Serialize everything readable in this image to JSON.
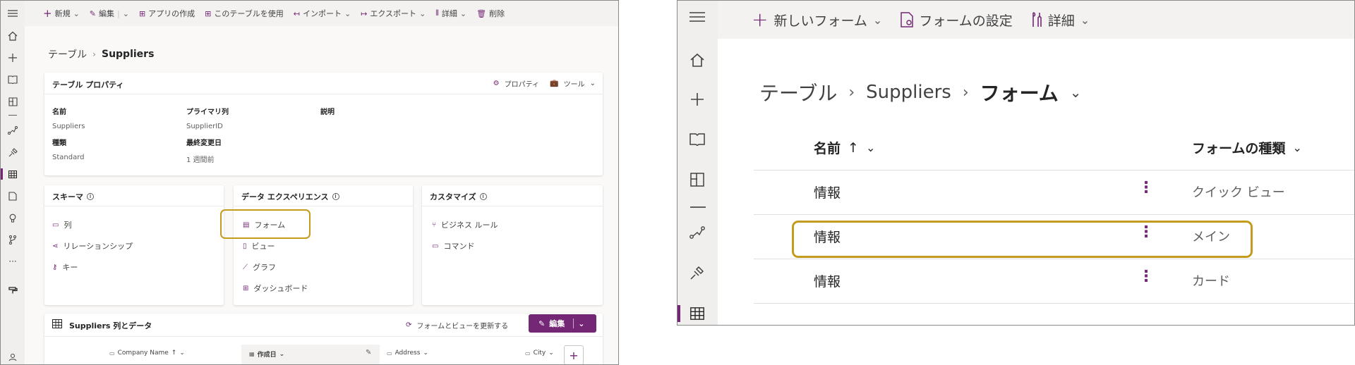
{
  "left": {
    "commands": {
      "new": "新規",
      "edit": "編集",
      "create_app": "アプリの作成",
      "use_table": "このテーブルを使用",
      "import": "インポート",
      "export": "エクスポート",
      "details": "詳細",
      "delete": "削除"
    },
    "breadcrumb": {
      "root": "テーブル",
      "current": "Suppliers"
    },
    "properties": {
      "title": "テーブル プロパティ",
      "properties_button": "プロパティ",
      "tools_button": "ツール",
      "name_label": "名前",
      "name_value": "Suppliers",
      "primary_label": "プライマリ列",
      "primary_value": "SupplierID",
      "desc_label": "説明",
      "type_label": "種類",
      "type_value": "Standard",
      "modified_label": "最終変更日",
      "modified_value": "1 週間前"
    },
    "schema": {
      "title": "スキーマ",
      "columns": "列",
      "relationships": "リレーションシップ",
      "keys": "キー"
    },
    "data_experience": {
      "title": "データ エクスペリエンス",
      "forms": "フォーム",
      "views": "ビュー",
      "charts": "グラフ",
      "dashboards": "ダッシュボード"
    },
    "customize": {
      "title": "カスタマイズ",
      "business_rules": "ビジネス ルール",
      "commands": "コマンド"
    },
    "columns_data": {
      "title": "Suppliers 列とデータ",
      "update_link": "フォームとビューを更新する",
      "edit_button": "編集",
      "col_company": "Company Name",
      "col_created": "作成日",
      "col_address": "Address",
      "col_city": "City"
    }
  },
  "right": {
    "commands": {
      "new_form": "新しいフォーム",
      "form_settings": "フォームの設定",
      "details": "詳細"
    },
    "breadcrumb": {
      "root": "テーブル",
      "table": "Suppliers",
      "current": "フォーム"
    },
    "headers": {
      "name": "名前",
      "sort_arrow": "↑",
      "form_type": "フォームの種類"
    },
    "rows": [
      {
        "name": "情報",
        "type": "クイック ビュー"
      },
      {
        "name": "情報",
        "type": "メイン"
      },
      {
        "name": "情報",
        "type": "カード"
      }
    ]
  },
  "colors": {
    "accent": "#742774",
    "highlight": "#c29b1f"
  }
}
